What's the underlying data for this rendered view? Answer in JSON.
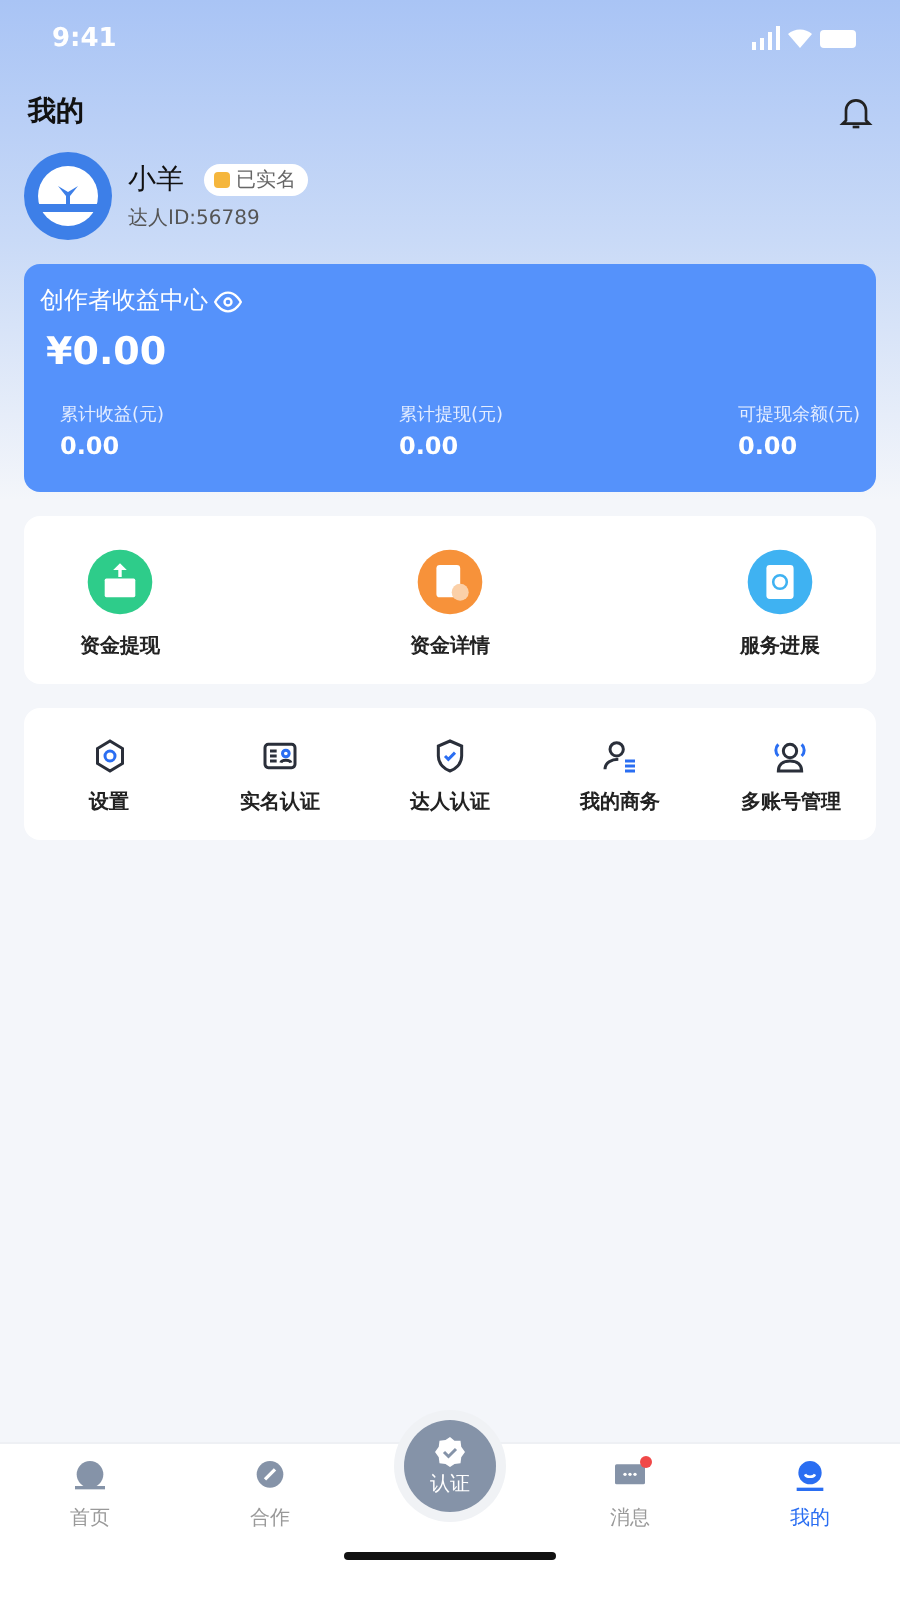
{
  "status_bar": {
    "time": "9:41"
  },
  "header": {
    "title": "我的"
  },
  "profile": {
    "name": "小羊",
    "badge": "已实名",
    "id_text": "达人ID:56789"
  },
  "earnings": {
    "title": "创作者收益中心",
    "total": "¥0.00",
    "stats": [
      {
        "label": "累计收益(元)",
        "value": "0.00"
      },
      {
        "label": "累计提现(元)",
        "value": "0.00"
      },
      {
        "label": "可提现余额(元)",
        "value": "0.00"
      }
    ]
  },
  "actions": [
    {
      "label": "资金提现",
      "kind": "withdraw",
      "color": "#2ecc8a"
    },
    {
      "label": "资金详情",
      "kind": "details",
      "color": "#f7923a"
    },
    {
      "label": "服务进展",
      "kind": "progress",
      "color": "#3fb2f2"
    }
  ],
  "menu": [
    {
      "label": "设置",
      "kind": "settings"
    },
    {
      "label": "实名认证",
      "kind": "idcard"
    },
    {
      "label": "达人认证",
      "kind": "shield"
    },
    {
      "label": "我的商务",
      "kind": "business"
    },
    {
      "label": "多账号管理",
      "kind": "accounts"
    }
  ],
  "tab_bar": [
    {
      "label": "首页",
      "kind": "home",
      "selected": false,
      "badge": false
    },
    {
      "label": "合作",
      "kind": "coop",
      "selected": false,
      "badge": false
    },
    {
      "label": "认证",
      "kind": "center",
      "selected": false,
      "badge": false
    },
    {
      "label": "消息",
      "kind": "message",
      "selected": false,
      "badge": true
    },
    {
      "label": "我的",
      "kind": "mine",
      "selected": true,
      "badge": false
    }
  ]
}
